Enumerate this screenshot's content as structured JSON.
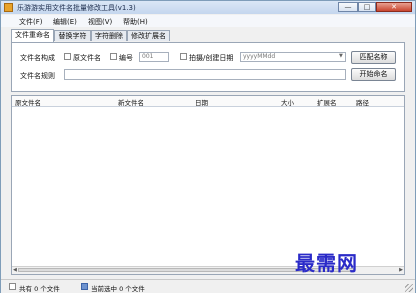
{
  "window": {
    "title": "乐游游实用文件名批量修改工具(v1.3)",
    "min_glyph": "—",
    "max_glyph": "□",
    "close_glyph": "✕"
  },
  "menubar": [
    "文件(F)",
    "编辑(E)",
    "视图(V)",
    "帮助(H)"
  ],
  "tabs": [
    "文件重命名",
    "替换字符",
    "字符删除",
    "修改扩展名"
  ],
  "panel": {
    "rule_label": "文件名构成",
    "original_name_label": "原文件名",
    "number_label": "编号",
    "number_value": "001",
    "date_label": "拍摄/创建日期",
    "date_format": "yyyyMMdd",
    "edit_name_button": "匹配名称",
    "name_rule_label": "文件名规则",
    "name_rule_value": "",
    "start_button": "开始命名"
  },
  "list": {
    "columns": [
      "原文件名",
      "新文件名",
      "日期",
      "大小",
      "扩展名",
      "路径"
    ]
  },
  "watermark": "最需网",
  "status": {
    "total": "共有 0 个文件",
    "selected": "当前选中 0 个文件"
  }
}
